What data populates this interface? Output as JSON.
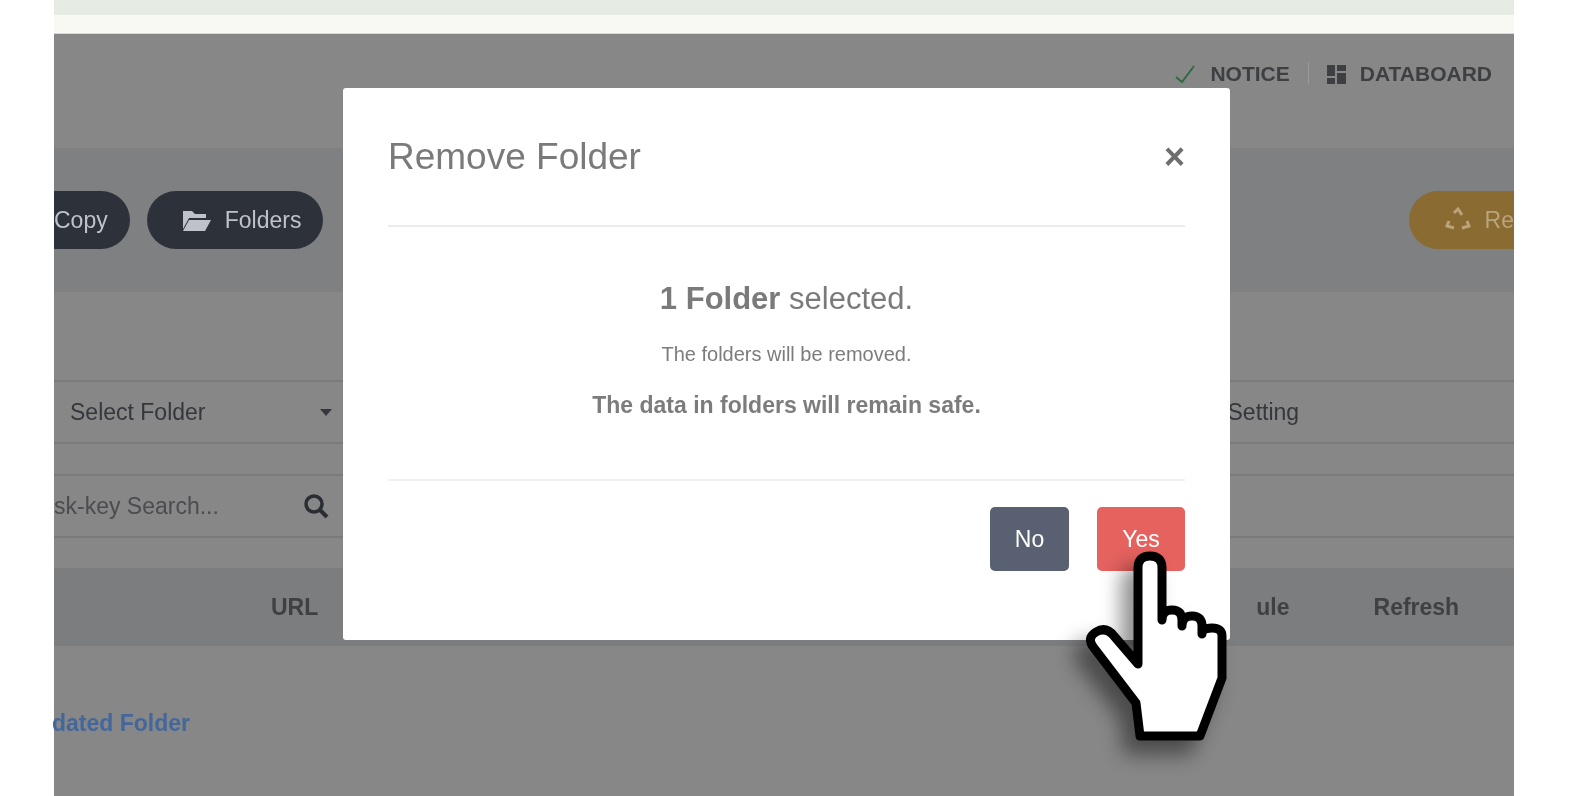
{
  "header": {
    "nav": [
      {
        "label": "NOTICE",
        "kind": "notice"
      },
      {
        "label": "DATABOARD",
        "kind": "databoard"
      }
    ]
  },
  "toolbar": {
    "buttons": [
      {
        "label": "Copy",
        "kind": "copy"
      },
      {
        "label": "Folders",
        "kind": "folders"
      },
      {
        "label": "Re",
        "kind": "recycle"
      }
    ]
  },
  "filters": {
    "folder_select": "Select Folder",
    "setting": "Setting",
    "search": {
      "placeholder": "sk-key Search..."
    }
  },
  "table": {
    "columns": [
      {
        "label": "URL",
        "kind": "url"
      },
      {
        "label": "ule",
        "kind": "schedule"
      },
      {
        "label": "Refresh",
        "kind": "refresh"
      }
    ],
    "rows": [
      {
        "name": "dated Folder"
      }
    ]
  },
  "dialog": {
    "title": "Remove Folder",
    "close": "×",
    "headline": "**1 Folder** selected.",
    "message": "The folders will be removed.",
    "note": "The data in folders will remain safe.",
    "buttons": [
      {
        "label": "No",
        "kind": "secondary"
      },
      {
        "label": "Yes",
        "kind": "danger"
      }
    ]
  }
}
